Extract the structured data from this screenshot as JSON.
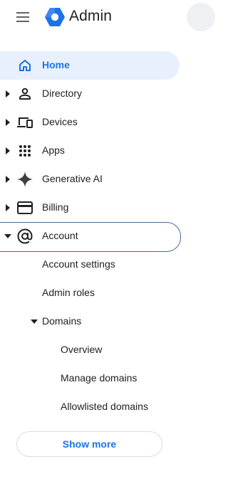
{
  "header": {
    "app_title": "Admin",
    "menu_icon": "hamburger-menu-icon",
    "logo_icon": "admin-hexagon-logo",
    "brand_color": "#1a73e8"
  },
  "nav": {
    "items": [
      {
        "label": "Home",
        "icon": "home-icon",
        "state": "active"
      },
      {
        "label": "Directory",
        "icon": "person-icon",
        "state": "collapsed"
      },
      {
        "label": "Devices",
        "icon": "devices-icon",
        "state": "collapsed"
      },
      {
        "label": "Apps",
        "icon": "apps-grid-icon",
        "state": "collapsed"
      },
      {
        "label": "Generative AI",
        "icon": "sparkle-icon",
        "state": "collapsed"
      },
      {
        "label": "Billing",
        "icon": "credit-card-icon",
        "state": "collapsed"
      },
      {
        "label": "Account",
        "icon": "at-sign-icon",
        "state": "expanded"
      }
    ],
    "account_children": {
      "account_settings": "Account settings",
      "admin_roles": "Admin roles",
      "domains": "Domains",
      "domains_children": [
        "Overview",
        "Manage domains",
        "Allowlisted domains"
      ]
    },
    "active_color": "#e8f0fe"
  },
  "footer": {
    "show_more": "Show more"
  }
}
